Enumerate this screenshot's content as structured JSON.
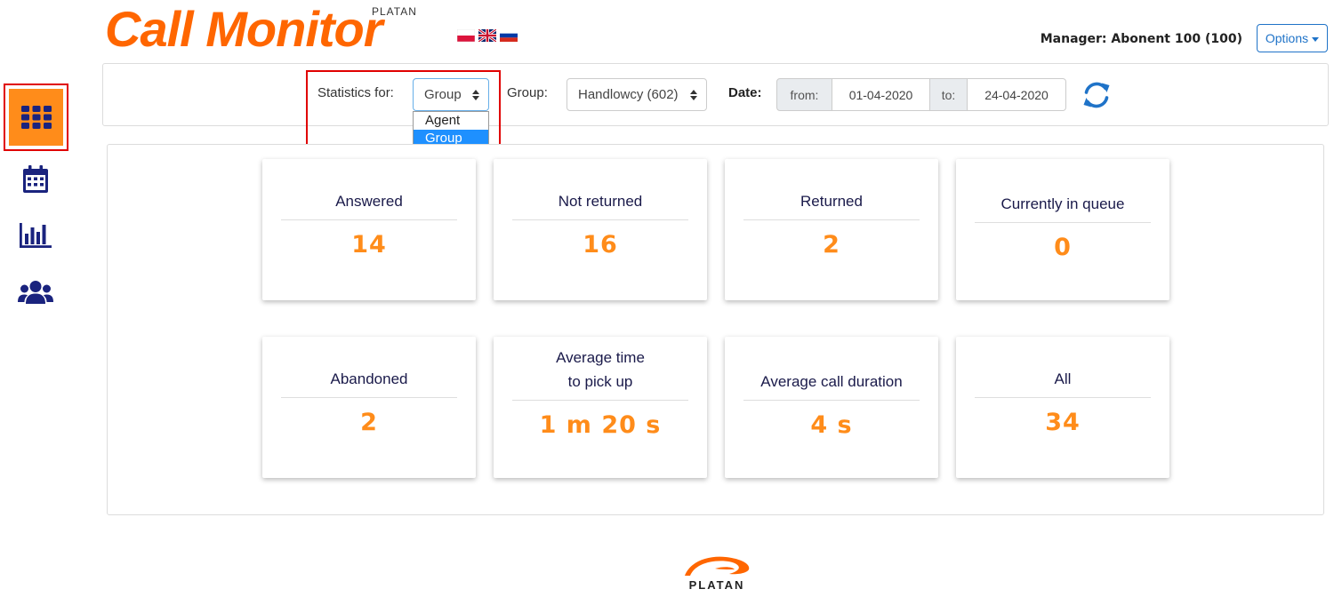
{
  "header": {
    "logo_text": "Call Monitor",
    "logo_sub": "PLATAN",
    "manager_label": "Manager: Abonent 100 (100)",
    "options_label": "Options",
    "flags": [
      "flag-pl-icon",
      "flag-uk-icon",
      "flag-ru-icon"
    ]
  },
  "sidebar": {
    "items": [
      {
        "icon": "grid-icon",
        "active": true
      },
      {
        "icon": "calendar-icon",
        "active": false
      },
      {
        "icon": "bar-chart-icon",
        "active": false
      },
      {
        "icon": "users-icon",
        "active": false
      }
    ]
  },
  "filters": {
    "stats_label": "Statistics for:",
    "stats_value": "Group",
    "stats_options": [
      "Agent",
      "Group"
    ],
    "group_label": "Group:",
    "group_value": "Handlowcy (602)",
    "date_label": "Date:",
    "from_label": "from:",
    "from_value": "01-04-2020",
    "to_label": "to:",
    "to_value": "24-04-2020"
  },
  "cards": [
    {
      "title": "Answered",
      "value": "14"
    },
    {
      "title": "Not returned",
      "value": "16"
    },
    {
      "title": "Returned",
      "value": "2"
    },
    {
      "title": "Currently in queue",
      "value": "0"
    },
    {
      "title": "Abandoned",
      "value": "2"
    },
    {
      "title_line1": "Average time",
      "title_line2": "to pick up",
      "value": "1 m 20 s"
    },
    {
      "title": "Average call duration",
      "value": "4 s"
    },
    {
      "title": "All",
      "value": "34"
    }
  ],
  "footer": {
    "logo_text": "PLATAN"
  },
  "colors": {
    "brand": "#ff6600",
    "accent": "#ff8c1a",
    "nav": "#1a237e",
    "link": "#1f73c8",
    "highlight": "#e00000"
  }
}
